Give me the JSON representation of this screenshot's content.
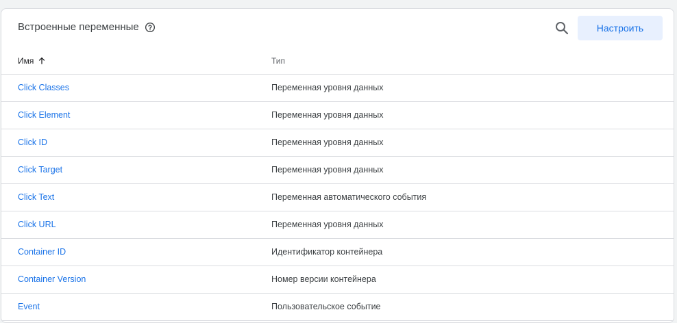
{
  "header": {
    "title": "Встроенные переменные",
    "help_icon": "help-circle-icon",
    "search_icon": "search-icon",
    "configure_label": "Настроить"
  },
  "table": {
    "columns": {
      "name": "Имя",
      "type": "Тип"
    },
    "sort_icon": "arrow-up-icon",
    "rows": [
      {
        "name": "Click Classes",
        "type": "Переменная уровня данных"
      },
      {
        "name": "Click Element",
        "type": "Переменная уровня данных"
      },
      {
        "name": "Click ID",
        "type": "Переменная уровня данных"
      },
      {
        "name": "Click Target",
        "type": "Переменная уровня данных"
      },
      {
        "name": "Click Text",
        "type": "Переменная автоматического события"
      },
      {
        "name": "Click URL",
        "type": "Переменная уровня данных"
      },
      {
        "name": "Container ID",
        "type": "Идентификатор контейнера"
      },
      {
        "name": "Container Version",
        "type": "Номер версии контейнера"
      },
      {
        "name": "Event",
        "type": "Пользовательское событие"
      }
    ]
  },
  "colors": {
    "link": "#1a73e8",
    "button_bg": "#e8f0fe",
    "divider": "#dadce0"
  }
}
